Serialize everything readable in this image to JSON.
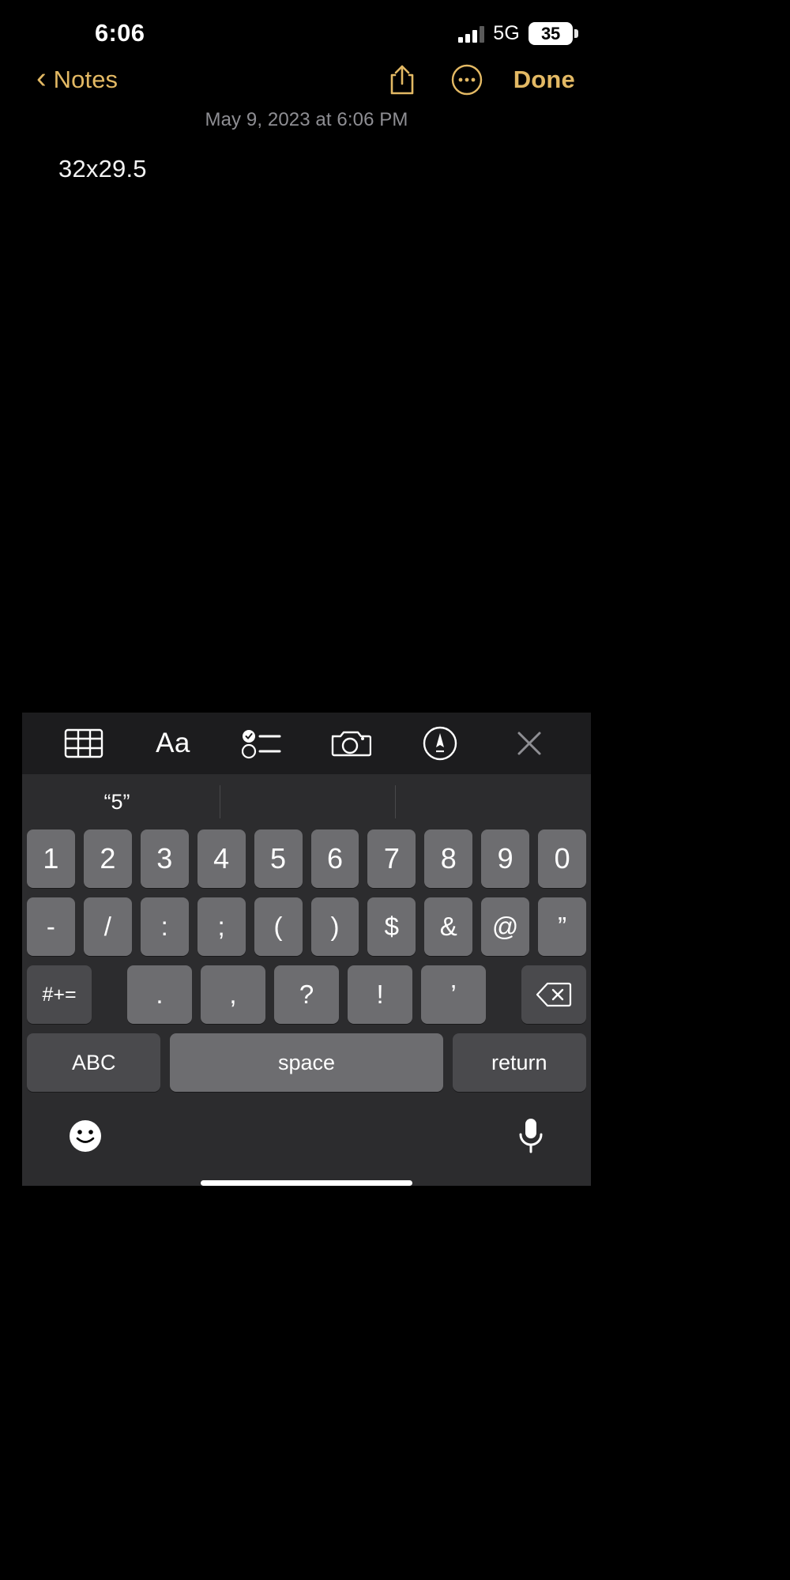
{
  "status_bar": {
    "time": "6:06",
    "network": "5G",
    "battery_level": "35",
    "signal_icon": "cellular-signal-icon",
    "battery_icon": "battery-icon"
  },
  "nav_bar": {
    "back_label": "Notes",
    "back_chevron": "‹",
    "share_icon": "share-icon",
    "more_icon": "more-ellipsis-icon",
    "done_label": "Done",
    "accent_color": "#e3b964"
  },
  "note": {
    "date": "May 9, 2023 at 6:06 PM",
    "body": "32x29.5"
  },
  "format_toolbar": {
    "items": [
      {
        "name": "table-icon",
        "label": ""
      },
      {
        "name": "text-format-icon",
        "label": "Aa"
      },
      {
        "name": "checklist-icon",
        "label": ""
      },
      {
        "name": "camera-icon",
        "label": ""
      },
      {
        "name": "markup-pen-icon",
        "label": ""
      },
      {
        "name": "close-icon",
        "label": ""
      }
    ]
  },
  "keyboard": {
    "predictive": {
      "suggestions": [
        "“5”",
        "",
        ""
      ]
    },
    "row1": [
      "1",
      "2",
      "3",
      "4",
      "5",
      "6",
      "7",
      "8",
      "9",
      "0"
    ],
    "row2": [
      "-",
      "/",
      ":",
      ";",
      "(",
      ")",
      "$",
      "&",
      "@",
      "”"
    ],
    "row3": {
      "symbol_switch": "#+=",
      "keys": [
        ".",
        ",",
        "?",
        "!",
        "’"
      ],
      "backspace_icon": "backspace-icon"
    },
    "row4": {
      "abc": "ABC",
      "space": "space",
      "return": "return"
    },
    "bottom": {
      "emoji_icon": "emoji-smiley-icon",
      "dictation_icon": "microphone-icon"
    }
  }
}
